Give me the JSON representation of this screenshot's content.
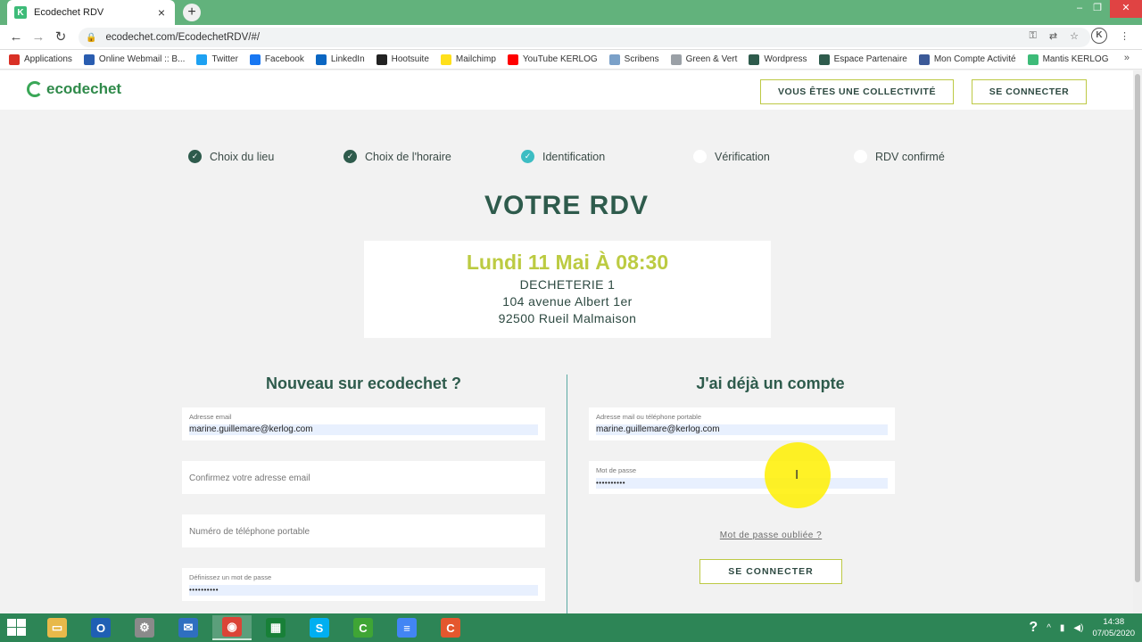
{
  "browser": {
    "tab_title": "Ecodechet RDV",
    "tab_favicon_letter": "K",
    "tab_close": "×",
    "new_tab": "+",
    "url": "ecodechet.com/EcodechetRDV/#/",
    "profile_letter": "K",
    "bookmarks": [
      {
        "label": "Applications",
        "icon": "apps-grid-icon",
        "color": "#d93025"
      },
      {
        "label": "Online Webmail :: B...",
        "icon": "webmail-icon",
        "color": "#2a5db0"
      },
      {
        "label": "Twitter",
        "icon": "twitter-icon",
        "color": "#1da1f2"
      },
      {
        "label": "Facebook",
        "icon": "facebook-icon",
        "color": "#1877f2"
      },
      {
        "label": "LinkedIn",
        "icon": "linkedin-icon",
        "color": "#0a66c2"
      },
      {
        "label": "Hootsuite",
        "icon": "hootsuite-icon",
        "color": "#222222"
      },
      {
        "label": "Mailchimp",
        "icon": "mailchimp-icon",
        "color": "#ffe01b"
      },
      {
        "label": "YouTube KERLOG",
        "icon": "youtube-icon",
        "color": "#ff0000"
      },
      {
        "label": "Scribens",
        "icon": "scribens-icon",
        "color": "#7aa0c8"
      },
      {
        "label": "Green & Vert",
        "icon": "green-vert-icon",
        "color": "#9aa0a6"
      },
      {
        "label": "Wordpress",
        "icon": "kerlog-icon",
        "color": "#2e5b4c"
      },
      {
        "label": "Espace Partenaire",
        "icon": "kerlog-icon",
        "color": "#2e5b4c"
      },
      {
        "label": "Mon Compte Activité",
        "icon": "account-icon",
        "color": "#3b5998"
      },
      {
        "label": "Mantis KERLOG",
        "icon": "kerlog-k-icon",
        "color": "#3dbb78"
      }
    ],
    "bookmarks_more": "»"
  },
  "site": {
    "logo": "ecodechet",
    "btn_collectivite": "VOUS ÊTES UNE COLLECTIVITÉ",
    "btn_connect_header": "SE CONNECTER"
  },
  "steps": [
    {
      "label": "Choix du lieu",
      "state": "done"
    },
    {
      "label": "Choix de l'horaire",
      "state": "done"
    },
    {
      "label": "Identification",
      "state": "active"
    },
    {
      "label": "Vérification",
      "state": "todo"
    },
    {
      "label": "RDV confirmé",
      "state": "todo"
    }
  ],
  "rdv": {
    "title": "VOTRE RDV",
    "date": "Lundi 11 Mai À 08:30",
    "place": "DECHETERIE 1",
    "address": "104 avenue Albert 1er",
    "city": "92500 Rueil Malmaison"
  },
  "new_account": {
    "title": "Nouveau sur ecodechet ?",
    "email_label": "Adresse email",
    "email_value": "marine.guillemare@kerlog.com",
    "confirm_placeholder": "Confirmez votre adresse email",
    "phone_placeholder": "Numéro de téléphone portable",
    "password_label": "Définissez un mot de passe",
    "password_value": "••••••••••"
  },
  "existing_account": {
    "title": "J'ai déjà un compte",
    "login_label": "Adresse mail ou téléphone portable",
    "login_value": "marine.guillemare@kerlog.com",
    "password_label": "Mot de passe",
    "password_value": "••••••••••",
    "forgot": "Mot de passe oubliée ?",
    "submit": "SE CONNECTER"
  },
  "taskbar": {
    "apps": [
      {
        "name": "file-explorer-icon",
        "color": "#e8b94a",
        "glyph": "▭"
      },
      {
        "name": "outlook-icon",
        "color": "#1f5fb4",
        "glyph": "O"
      },
      {
        "name": "settings-app-icon",
        "color": "#8a8a8a",
        "glyph": "⚙"
      },
      {
        "name": "thunderbird-icon",
        "color": "#2f6fc0",
        "glyph": "✉"
      },
      {
        "name": "chrome-icon",
        "color": "#db4437",
        "glyph": "◉"
      },
      {
        "name": "sheets-icon",
        "color": "#188038",
        "glyph": "▦"
      },
      {
        "name": "skype-icon",
        "color": "#00aff0",
        "glyph": "S"
      },
      {
        "name": "camtasia-icon",
        "color": "#3fa535",
        "glyph": "C"
      },
      {
        "name": "docs-icon",
        "color": "#4285f4",
        "glyph": "≡"
      },
      {
        "name": "camtasia-recorder-icon",
        "color": "#e4572e",
        "glyph": "C"
      }
    ],
    "time": "14:38",
    "date": "07/05/2020"
  }
}
